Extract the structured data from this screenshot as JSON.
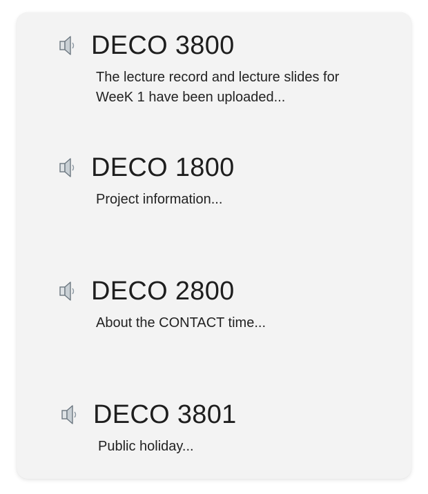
{
  "announcements": [
    {
      "course": "DECO 3800",
      "summary": "The lecture record and lecture slides for WeeK 1 have been uploaded...",
      "icon": "speaker-icon"
    },
    {
      "course": "DECO 1800",
      "summary": "Project information...",
      "icon": "speaker-icon"
    },
    {
      "course": "DECO 2800",
      "summary": "About the CONTACT time...",
      "icon": "speaker-icon"
    },
    {
      "course": "DECO 3801",
      "summary": "Public holiday...",
      "icon": "speaker-icon"
    }
  ],
  "colors": {
    "card_background": "#f3f3f3",
    "text": "#1e1e1e",
    "icon": "#8a96a0"
  }
}
